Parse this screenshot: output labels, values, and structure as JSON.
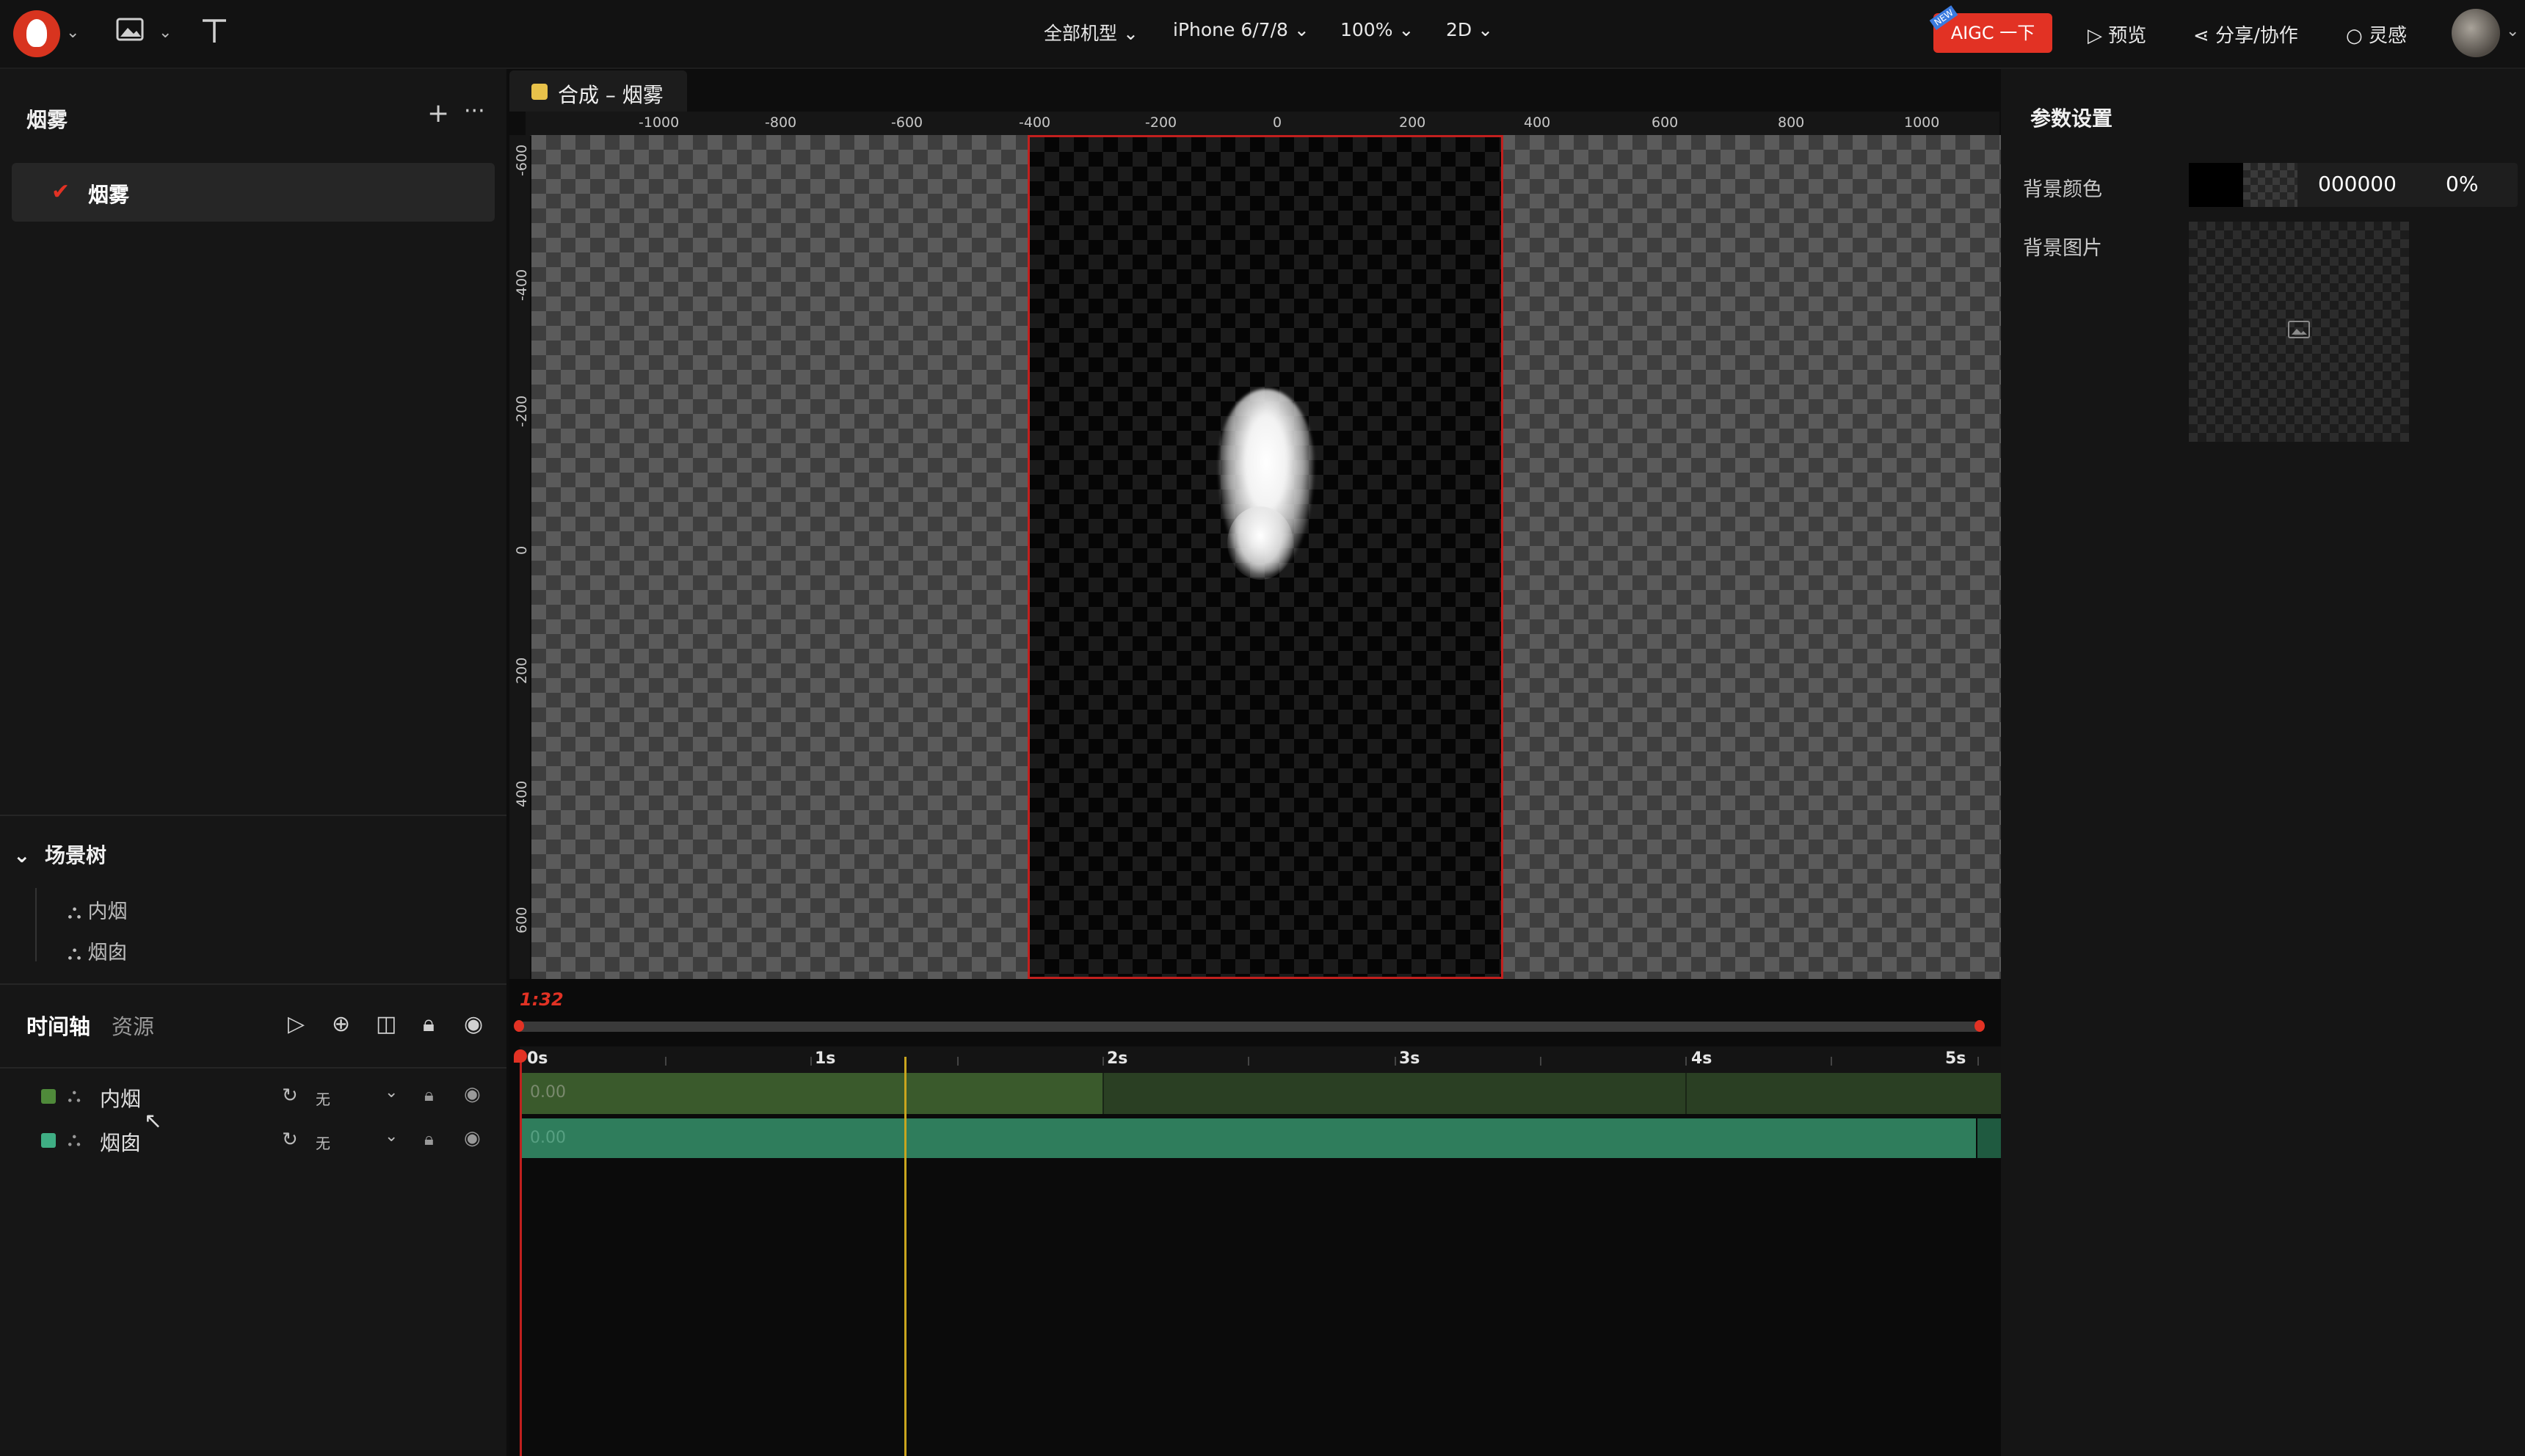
{
  "toolbar": {
    "device_menu": "全部机型",
    "device_select": "iPhone 6/7/8",
    "zoom_select": "100%",
    "mode_select": "2D",
    "aigc_label": "AIGC 一下",
    "aigc_badge": "NEW",
    "preview_label": "预览",
    "share_label": "分享/协作",
    "inspiration_label": "灵感"
  },
  "left_panel": {
    "title": "烟雾",
    "selected_item": "烟雾",
    "scene_tree_title": "场景树",
    "scene_items": [
      "内烟",
      "烟囱"
    ]
  },
  "canvas": {
    "tab_title": "合成 – 烟雾",
    "h_ruler": [
      "-1000",
      "-800",
      "-600",
      "-400",
      "-200",
      "0",
      "200",
      "400",
      "600",
      "800",
      "1000"
    ],
    "v_ruler": [
      "-600",
      "-400",
      "-200",
      "0",
      "200",
      "400",
      "600"
    ],
    "background_color": "#000000"
  },
  "right_panel": {
    "title": "参数设置",
    "bg_color_label": "背景颜色",
    "bg_color_value": "000000",
    "bg_opacity": "0%",
    "bg_image_label": "背景图片"
  },
  "timeline": {
    "tab_timeline": "时间轴",
    "tab_assets": "资源",
    "timecode": "1:32",
    "seconds": [
      "0s",
      "1s",
      "2s",
      "3s",
      "4s",
      "5s"
    ],
    "tracks": [
      {
        "name": "内烟",
        "color": "#4f8a3a",
        "blend": "无",
        "value": "0.00"
      },
      {
        "name": "烟囱",
        "color": "#3fae84",
        "blend": "无",
        "value": "0.00"
      }
    ]
  },
  "colors": {
    "accent": "#e23224",
    "stage_border": "#c2201e",
    "playhead": "#c0201e",
    "cursor_line": "#c9a51e"
  }
}
